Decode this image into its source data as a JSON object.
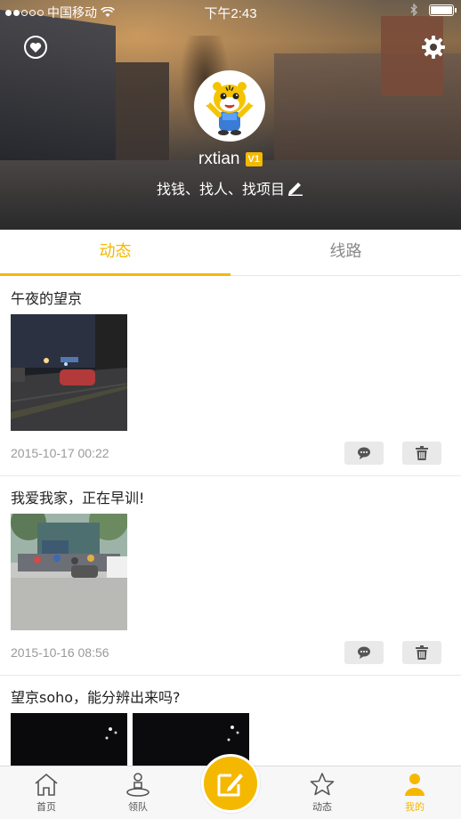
{
  "status_bar": {
    "carrier": "中国移动",
    "time": "下午2:43"
  },
  "profile": {
    "username": "rxtian",
    "badge": "V1",
    "signature": "找钱、找人、找项目"
  },
  "tabs": [
    {
      "label": "动态",
      "active": true
    },
    {
      "label": "线路",
      "active": false
    }
  ],
  "posts": [
    {
      "text": "午夜的望京",
      "date": "2015-10-17 00:22",
      "photo_count": 1
    },
    {
      "text": "我爱我家，正在早训!",
      "date": "2015-10-16 08:56",
      "photo_count": 1
    },
    {
      "text": "望京soho，能分辨出来吗?",
      "date": "",
      "photo_count": 2
    }
  ],
  "bottom_nav": [
    {
      "label": "首页",
      "icon": "home-icon"
    },
    {
      "label": "领队",
      "icon": "leader-icon"
    },
    {
      "label": "",
      "icon": "compose-icon"
    },
    {
      "label": "动态",
      "icon": "star-icon"
    },
    {
      "label": "我的",
      "icon": "user-icon",
      "active": true
    }
  ],
  "colors": {
    "accent": "#f5b800",
    "inactive_tab": "#8a8a8a",
    "date_text": "#9a9a9a"
  }
}
